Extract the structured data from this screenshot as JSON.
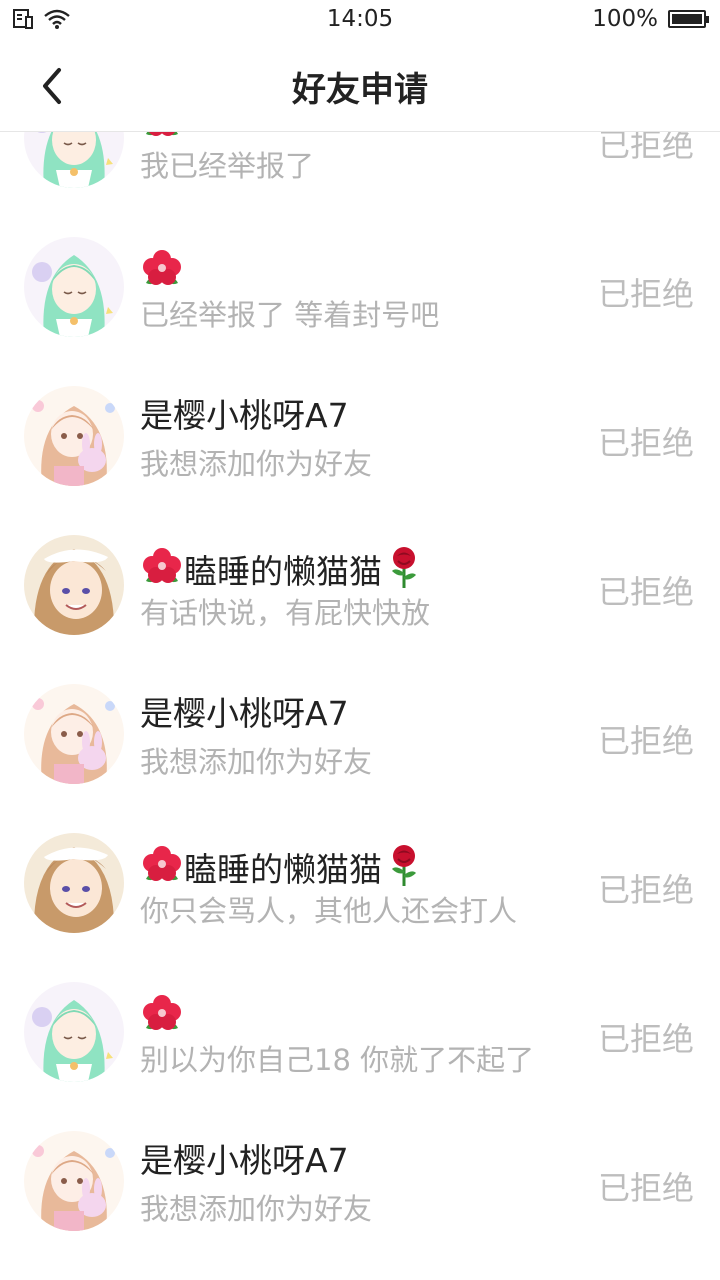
{
  "status_bar": {
    "time": "14:05",
    "battery": "100%"
  },
  "header": {
    "title": "好友申请"
  },
  "requests": [
    {
      "avatar": "avatar-green-hair",
      "name": "",
      "message": "我已经举报了",
      "status": "已拒绝",
      "prefix_icon": "hibiscus-icon",
      "suffix_icon": ""
    },
    {
      "avatar": "avatar-green-hair",
      "name": "",
      "message": "已经举报了 等着封号吧",
      "status": "已拒绝",
      "prefix_icon": "hibiscus-icon",
      "suffix_icon": ""
    },
    {
      "avatar": "avatar-pink-bunny",
      "name": "是樱小桃呀A7",
      "message": "我想添加你为好友",
      "status": "已拒绝",
      "prefix_icon": "",
      "suffix_icon": ""
    },
    {
      "avatar": "avatar-brown-hair",
      "name": "瞌睡的懒猫猫",
      "message": "有话快说，有屁快快放",
      "status": "已拒绝",
      "prefix_icon": "hibiscus-icon",
      "suffix_icon": "rose-icon"
    },
    {
      "avatar": "avatar-pink-bunny",
      "name": "是樱小桃呀A7",
      "message": "我想添加你为好友",
      "status": "已拒绝",
      "prefix_icon": "",
      "suffix_icon": ""
    },
    {
      "avatar": "avatar-brown-hair",
      "name": "瞌睡的懒猫猫",
      "message": "你只会骂人，其他人还会打人",
      "status": "已拒绝",
      "prefix_icon": "hibiscus-icon",
      "suffix_icon": "rose-icon"
    },
    {
      "avatar": "avatar-green-hair",
      "name": "",
      "message": "别以为你自己18 你就了不起了",
      "status": "已拒绝",
      "prefix_icon": "hibiscus-icon",
      "suffix_icon": ""
    },
    {
      "avatar": "avatar-pink-bunny",
      "name": "是樱小桃呀A7",
      "message": "我想添加你为好友",
      "status": "已拒绝",
      "prefix_icon": "",
      "suffix_icon": ""
    }
  ],
  "colors": {
    "title": "#222222",
    "secondary": "#b3b3b3",
    "status": "#bdbdbd",
    "divider": "#e6e6e6"
  }
}
